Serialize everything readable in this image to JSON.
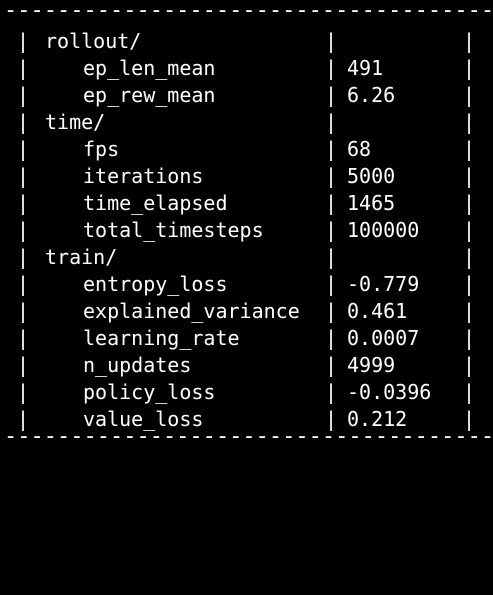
{
  "terminal": {
    "rule_top": "------------------------------------------",
    "rule_bottom": "------------------------------------------",
    "column_separator": "|",
    "sections": [
      {
        "name": "rollout/",
        "rows": [
          {
            "key": "ep_len_mean",
            "value": "491"
          },
          {
            "key": "ep_rew_mean",
            "value": "6.26"
          }
        ]
      },
      {
        "name": "time/",
        "rows": [
          {
            "key": "fps",
            "value": "68"
          },
          {
            "key": "iterations",
            "value": "5000"
          },
          {
            "key": "time_elapsed",
            "value": "1465"
          },
          {
            "key": "total_timesteps",
            "value": "100000"
          }
        ]
      },
      {
        "name": "train/",
        "rows": [
          {
            "key": "entropy_loss",
            "value": "-0.779"
          },
          {
            "key": "explained_variance",
            "value": "0.461"
          },
          {
            "key": "learning_rate",
            "value": "0.0007"
          },
          {
            "key": "n_updates",
            "value": "4999"
          },
          {
            "key": "policy_loss",
            "value": "-0.0396"
          },
          {
            "key": "value_loss",
            "value": "0.212"
          }
        ]
      }
    ]
  },
  "colors": {
    "background": "#000000",
    "text": "#ffffff"
  }
}
